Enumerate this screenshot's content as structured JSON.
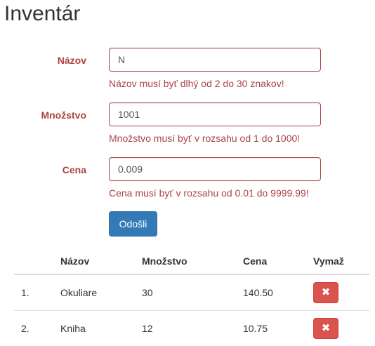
{
  "page": {
    "title": "Inventár"
  },
  "form": {
    "fields": [
      {
        "label": "Názov",
        "value": "N",
        "error": "Názov musí byť dlhý od 2 do 30 znakov!"
      },
      {
        "label": "Množstvo",
        "value": "1001",
        "error": "Množstvo musí byť v rozsahu od 1 do 1000!"
      },
      {
        "label": "Cena",
        "value": "0.009",
        "error": "Cena musí byť v rozsahu od 0.01 do 9999.99!"
      }
    ],
    "submit_label": "Odošli"
  },
  "table": {
    "headers": [
      "",
      "Názov",
      "Množstvo",
      "Cena",
      "Vymaž"
    ],
    "rows": [
      {
        "index": "1.",
        "name": "Okuliare",
        "quantity": "30",
        "price": "140.50"
      },
      {
        "index": "2.",
        "name": "Kniha",
        "quantity": "12",
        "price": "10.75"
      }
    ],
    "delete_icon": "✖"
  },
  "colors": {
    "error": "#a94442",
    "primary": "#337ab7",
    "danger": "#d9534f"
  }
}
